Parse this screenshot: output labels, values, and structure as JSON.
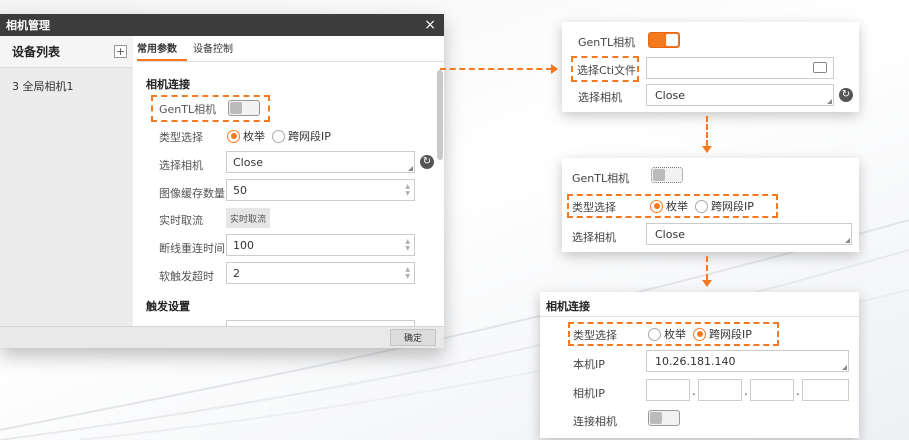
{
  "dialog": {
    "title": "相机管理",
    "close_icon": "×",
    "left": {
      "header": "设备列表",
      "add_icon": "+",
      "device": "3  全局相机1"
    },
    "tabs": [
      "常用参数",
      "设备控制"
    ],
    "section1": "相机连接",
    "gentl_label": "GenTL相机",
    "type_label": "类型选择",
    "type_options": [
      "枚举",
      "跨网段IP"
    ],
    "camera_label": "选择相机",
    "camera_value": "Close",
    "buffer_label": "图像缓存数量",
    "buffer_value": "50",
    "realtime_label": "实时取流",
    "realtime_button": "实时取流",
    "reconnect_label": "断线重连时间",
    "reconnect_value": "100",
    "timeout_label": "软触发超时",
    "timeout_value": "2",
    "section2": "触发设置",
    "ok_button": "确定"
  },
  "panel1": {
    "gentl_label": "GenTL相机",
    "cti_label": "选择Cti文件",
    "cti_value": "",
    "camera_label": "选择相机",
    "camera_value": "Close"
  },
  "panel2": {
    "gentl_label": "GenTL相机",
    "type_label": "类型选择",
    "type_options": [
      "枚举",
      "跨网段IP"
    ],
    "camera_label": "选择相机",
    "camera_value": "Close"
  },
  "panel3": {
    "section": "相机连接",
    "type_label": "类型选择",
    "type_options": [
      "枚举",
      "跨网段IP"
    ],
    "local_ip_label": "本机IP",
    "local_ip_value": "10.26.181.140",
    "camera_ip_label": "相机IP",
    "connect_label": "连接相机"
  },
  "colors": {
    "accent": "#f47920",
    "titlebar": "#3c3c3c"
  }
}
